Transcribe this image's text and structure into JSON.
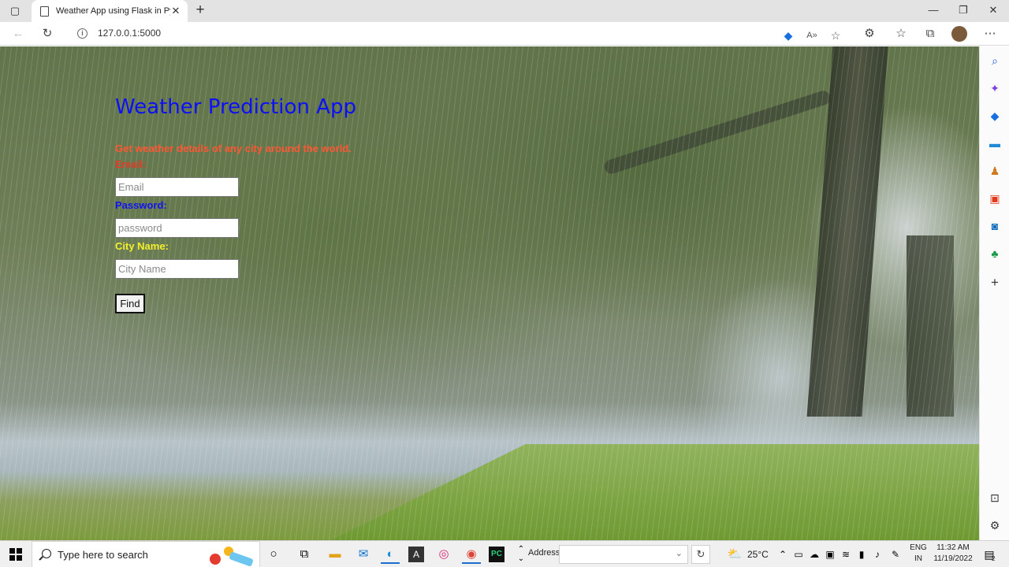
{
  "browser": {
    "tab_title": "Weather App using Flask in Python",
    "url": "127.0.0.1:5000"
  },
  "page": {
    "title": "Weather Prediction App",
    "subtitle": "Get weather details of any city around the world.",
    "email_label": "Email:",
    "email_placeholder": "Email",
    "password_label": "Password:",
    "password_placeholder": "password",
    "city_label": "City Name:",
    "city_placeholder": "City Name",
    "find_label": "Find"
  },
  "colors": {
    "title": "#0d10f5",
    "subtitle": "#ff5733",
    "email_label": "#e03c28",
    "password_label": "#1015f0",
    "city_label": "#f2ef2c"
  },
  "taskbar": {
    "search_placeholder": "Type here to search",
    "address_label": "Address",
    "temperature": "25°C",
    "lang_line1": "ENG",
    "lang_line2": "IN",
    "time": "11:32 AM",
    "date": "11/19/2022",
    "notification_count": "2"
  },
  "icons": {
    "sidebar": [
      "search-icon",
      "copilot-icon",
      "shopping-tag-icon",
      "tools-icon",
      "games-icon",
      "office-icon",
      "outlook-icon",
      "tree-icon",
      "add-icon",
      "split-screen-icon",
      "settings-icon"
    ],
    "taskbar": [
      "start-icon",
      "cortana-icon",
      "task-view-icon",
      "file-explorer-icon",
      "mail-icon",
      "edge-icon",
      "font-app-icon",
      "instagram-icon",
      "chrome-icon",
      "pycharm-icon"
    ]
  }
}
